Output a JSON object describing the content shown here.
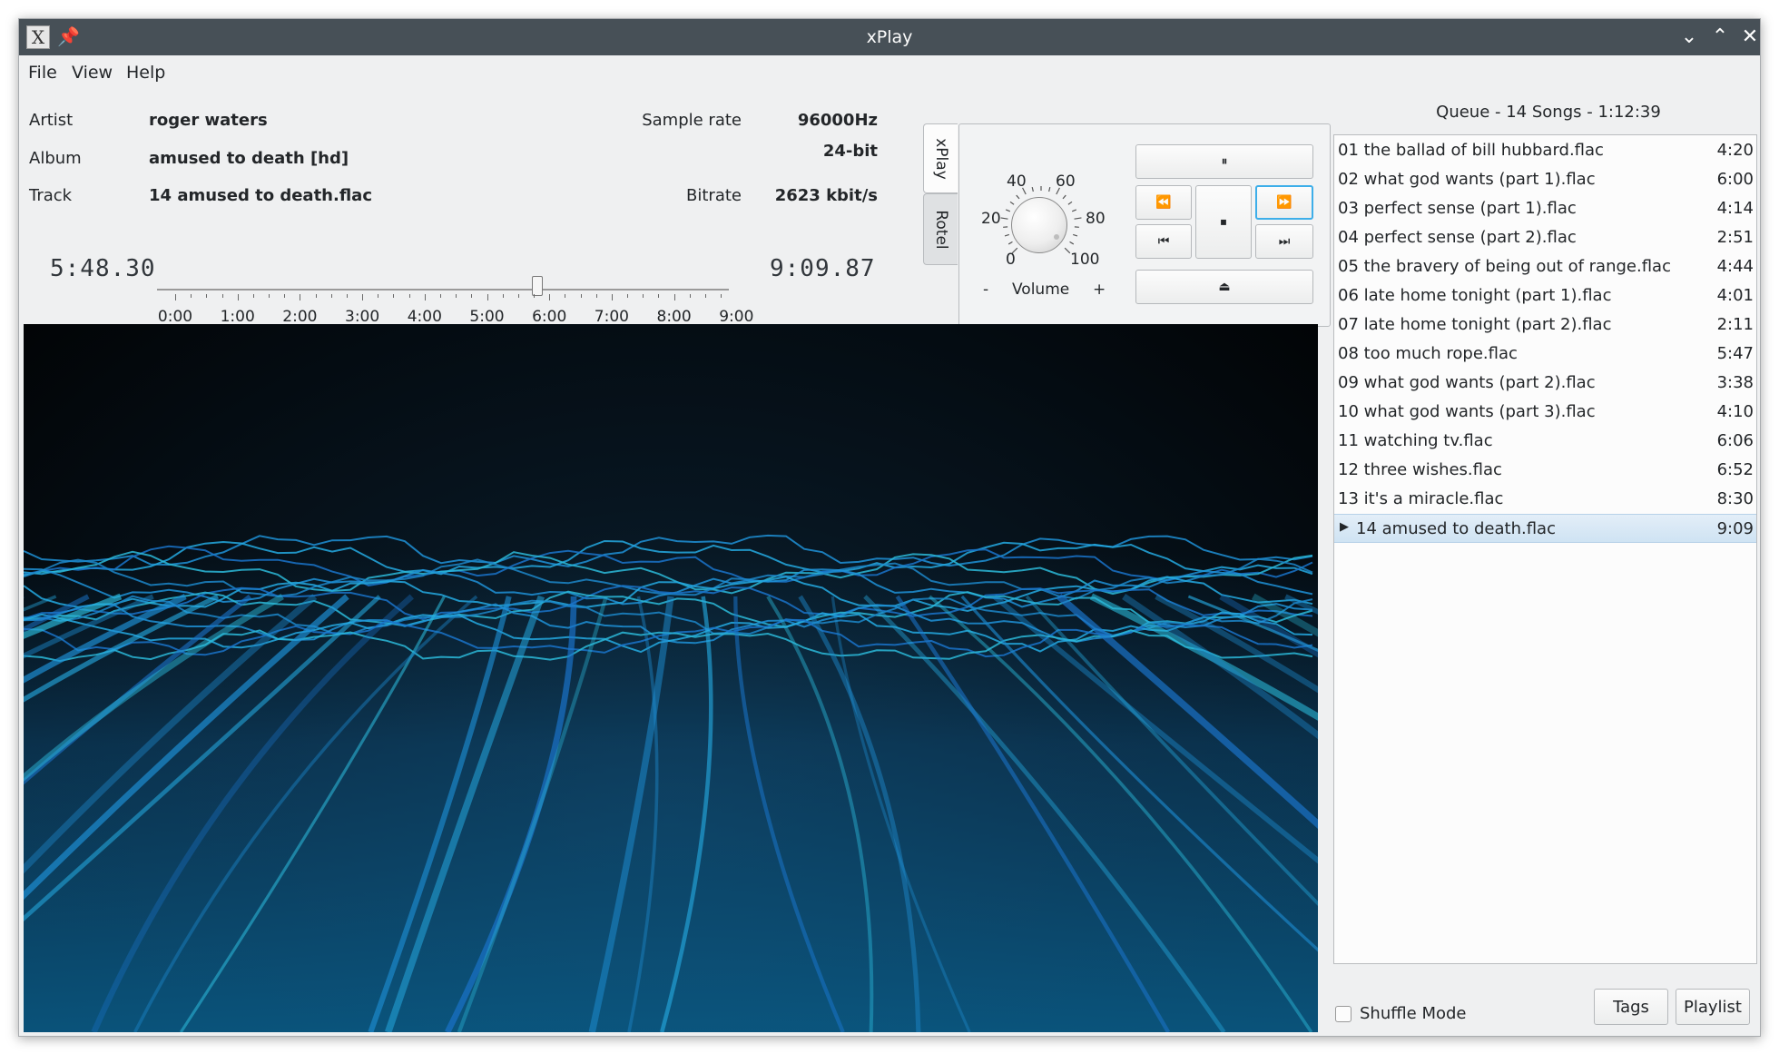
{
  "window": {
    "title": "xPlay",
    "app_icon": "X",
    "pin_icon": "📌",
    "minimize_icon": "⌄",
    "maximize_icon": "⌃",
    "close_icon": "✕"
  },
  "menu": [
    "File",
    "View",
    "Help"
  ],
  "info": {
    "artist_label": "Artist",
    "artist": "roger waters",
    "album_label": "Album",
    "album": "amused to death [hd]",
    "track_label": "Track",
    "track": "14 amused to death.flac",
    "sample_rate_label": "Sample rate",
    "sample_rate": "96000Hz",
    "bit_depth": "24-bit",
    "bitrate_label": "Bitrate",
    "bitrate": "2623 kbit/s"
  },
  "playback": {
    "elapsed": "5:48.30",
    "total": "9:09.87",
    "position_seconds": 348.3,
    "length_seconds": 549.87,
    "tick_labels": [
      "0:00",
      "1:00",
      "2:00",
      "3:00",
      "4:00",
      "5:00",
      "6:00",
      "7:00",
      "8:00",
      "9:00"
    ]
  },
  "tabs": {
    "active": "xPlay",
    "inactive": "Rotel"
  },
  "volume": {
    "label": "Volume",
    "minus": "-",
    "plus": "+",
    "scale": [
      "0",
      "20",
      "40",
      "60",
      "80",
      "100"
    ]
  },
  "controls": {
    "pause": "⏸",
    "rewind": "⏪",
    "fast_forward": "⏩",
    "stop": "⏹",
    "previous": "⏮",
    "next": "⏭",
    "eject": "⏏"
  },
  "queue": {
    "title": "Queue - 14 Songs - 1:12:39",
    "current_index": 13,
    "items": [
      {
        "name": "01 the ballad of bill hubbard.flac",
        "duration": "4:20"
      },
      {
        "name": "02 what god wants (part 1).flac",
        "duration": "6:00"
      },
      {
        "name": "03 perfect sense (part 1).flac",
        "duration": "4:14"
      },
      {
        "name": "04 perfect sense (part 2).flac",
        "duration": "2:51"
      },
      {
        "name": "05 the bravery of being out of range.flac",
        "duration": "4:44"
      },
      {
        "name": "06 late home tonight (part 1).flac",
        "duration": "4:01"
      },
      {
        "name": "07 late home tonight (part 2).flac",
        "duration": "2:11"
      },
      {
        "name": "08 too much rope.flac",
        "duration": "5:47"
      },
      {
        "name": "09 what god wants (part 2).flac",
        "duration": "3:38"
      },
      {
        "name": "10 what god wants (part 3).flac",
        "duration": "4:10"
      },
      {
        "name": "11 watching tv.flac",
        "duration": "6:06"
      },
      {
        "name": "12 three wishes.flac",
        "duration": "6:52"
      },
      {
        "name": "13 it's a miracle.flac",
        "duration": "8:30"
      },
      {
        "name": "14 amused to death.flac",
        "duration": "9:09"
      }
    ]
  },
  "footer": {
    "shuffle_label": "Shuffle Mode",
    "shuffle_checked": false,
    "tags_button": "Tags",
    "playlist_button": "Playlist"
  }
}
